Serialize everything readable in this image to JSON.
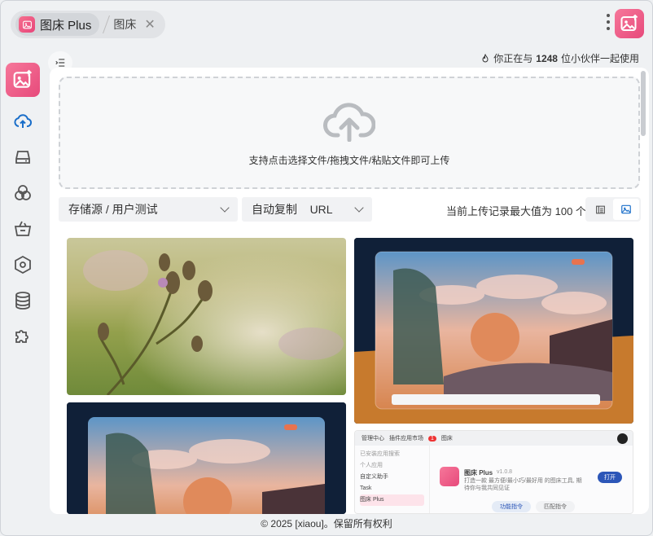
{
  "tabs": [
    {
      "label": "图床 Plus"
    },
    {
      "label": "图床"
    }
  ],
  "online": {
    "prefix": "你正在与",
    "count": "1248",
    "suffix": "位小伙伴一起使用"
  },
  "sidebar": {
    "items": [
      {
        "icon": "cloud-upload-icon"
      },
      {
        "icon": "storage-drive-icon"
      },
      {
        "icon": "circles-icon"
      },
      {
        "icon": "basket-icon"
      },
      {
        "icon": "hexagon-icon"
      },
      {
        "icon": "database-icon"
      },
      {
        "icon": "puzzle-icon"
      }
    ]
  },
  "upload": {
    "hint": "支持点击选择文件/拖拽文件/粘贴文件即可上传"
  },
  "controls": {
    "storage": "存储源 / 用户测试",
    "autocopy_label": "自动复制",
    "autocopy_value": "URL",
    "max_info": "当前上传记录最大值为 100 个"
  },
  "mini_app": {
    "tab_manage": "管理中心",
    "tab_market": "插件应用市场",
    "tab_img": "图床",
    "badge": "1",
    "sidebar_title": "已安装应用搜索",
    "section": "个人应用",
    "items": [
      "自定义助手",
      "Task",
      "图床 Plus"
    ],
    "app_name": "图床 Plus",
    "version": "v1.0.8",
    "desc": "打造一款 最方便/最小巧/最好用 的图床工具, 期待你与我共同见证",
    "open": "打开",
    "btn1": "功能指令",
    "btn2": "匹配指令"
  },
  "colors": {
    "brand": "#e8457a",
    "accent": "#1a6ec9"
  },
  "footer": "© 2025 [xiaou]。保留所有权利"
}
